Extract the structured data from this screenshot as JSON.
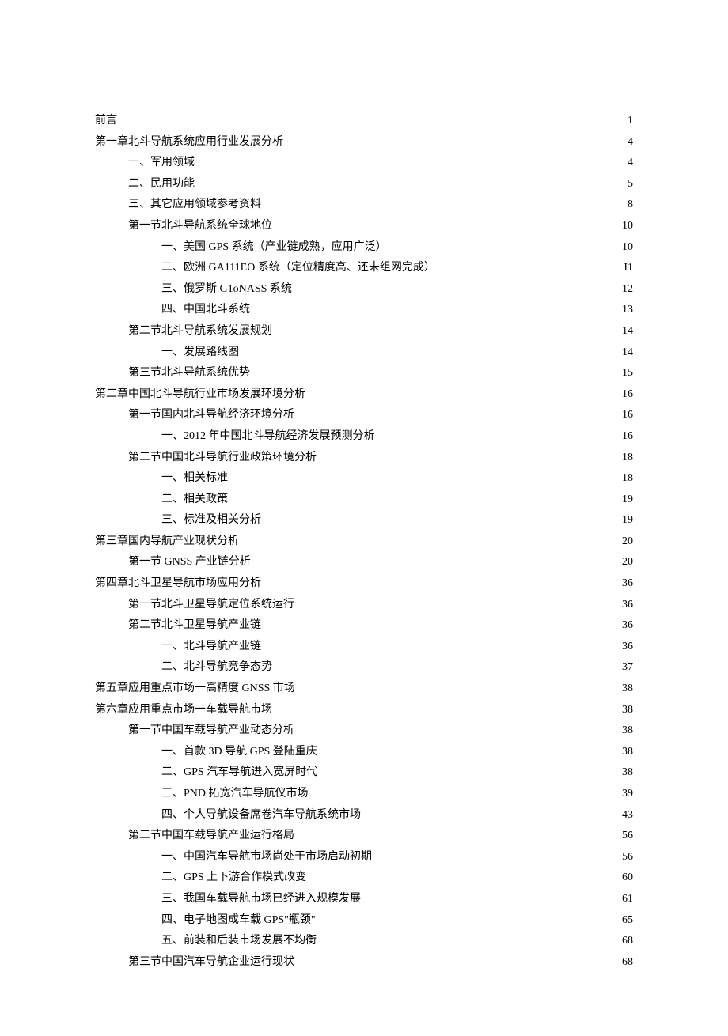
{
  "toc": [
    {
      "level": 0,
      "label": "前言",
      "page": "1"
    },
    {
      "level": 0,
      "label": "第一章北斗导航系统应用行业发展分析",
      "page": "4"
    },
    {
      "level": 1,
      "label": "一、军用领域",
      "page": "4"
    },
    {
      "level": 1,
      "label": "二、民用功能",
      "page": "5"
    },
    {
      "level": 1,
      "label": "三、其它应用领域参考资料",
      "page": "8"
    },
    {
      "level": 1,
      "label": "第一节北斗导航系统全球地位",
      "page": "10"
    },
    {
      "level": 2,
      "label": "一、美国 GPS 系统（产业链成熟，应用广泛）",
      "page": "10"
    },
    {
      "level": 2,
      "label": "二、欧洲 GA111EO 系统（定位精度高、还未组网完成）",
      "page": "I1"
    },
    {
      "level": 2,
      "label": "三、俄罗斯 G1oNASS 系统",
      "page": "12"
    },
    {
      "level": 2,
      "label": "四、中国北斗系统",
      "page": "13"
    },
    {
      "level": 1,
      "label": "第二节北斗导航系统发展规划",
      "page": "14"
    },
    {
      "level": 2,
      "label": "一、发展路线图",
      "page": "14"
    },
    {
      "level": 1,
      "label": "第三节北斗导航系统优势",
      "page": "15"
    },
    {
      "level": 0,
      "label": "第二章中国北斗导航行业市场发展环境分析",
      "page": "16"
    },
    {
      "level": 1,
      "label": "第一节国内北斗导航经济环境分析",
      "page": "16"
    },
    {
      "level": 2,
      "label": "一、2012 年中国北斗导航经济发展预测分析",
      "page": "16"
    },
    {
      "level": 1,
      "label": "第二节中国北斗导航行业政策环境分析",
      "page": "18"
    },
    {
      "level": 2,
      "label": "一、相关标准",
      "page": "18"
    },
    {
      "level": 2,
      "label": "二、相关政策",
      "page": "19"
    },
    {
      "level": 2,
      "label": "三、标准及相关分析",
      "page": "19"
    },
    {
      "level": 0,
      "label": "第三章国内导航产业现状分析",
      "page": "20"
    },
    {
      "level": 1,
      "label": "第一节 GNSS 产业链分析",
      "page": "20"
    },
    {
      "level": 0,
      "label": "第四章北斗卫星导航市场应用分析",
      "page": "36"
    },
    {
      "level": 1,
      "label": "第一节北斗卫星导航定位系统运行",
      "page": "36"
    },
    {
      "level": 1,
      "label": "第二节北斗卫星导航产业链",
      "page": "36"
    },
    {
      "level": 2,
      "label": "一、北斗导航产业链",
      "page": "36"
    },
    {
      "level": 2,
      "label": "二、北斗导航竞争态势",
      "page": "37"
    },
    {
      "level": 0,
      "label": "第五章应用重点市场一高精度 GNSS 市场",
      "page": "38"
    },
    {
      "level": 0,
      "label": "第六章应用重点市场一车载导航市场",
      "page": "38"
    },
    {
      "level": 1,
      "label": "第一节中国车载导航产业动态分析",
      "page": "38"
    },
    {
      "level": 2,
      "label": "一、首款 3D 导航 GPS 登陆重庆",
      "page": "38"
    },
    {
      "level": 2,
      "label": "二、GPS 汽车导航进入宽屏时代",
      "page": "38"
    },
    {
      "level": 2,
      "label": "三、PND 拓宽汽车导航仪市场",
      "page": "39"
    },
    {
      "level": 2,
      "label": "四、个人导航设备席卷汽车导航系统市场",
      "page": "43"
    },
    {
      "level": 1,
      "label": "第二节中国车载导航产业运行格局",
      "page": "56"
    },
    {
      "level": 2,
      "label": "一、中国汽车导航市场尚处于市场启动初期",
      "page": "56"
    },
    {
      "level": 2,
      "label": "二、GPS 上下游合作模式改变",
      "page": "60"
    },
    {
      "level": 2,
      "label": "三、我国车载导航市场已经进入规模发展",
      "page": "61"
    },
    {
      "level": 2,
      "label": "四、电子地图成车载 GPS\"瓶颈\"",
      "page": "65"
    },
    {
      "level": 2,
      "label": "五、前装和后装市场发展不均衡",
      "page": "68"
    },
    {
      "level": 1,
      "label": "第三节中国汽车导航企业运行现状",
      "page": "68"
    }
  ]
}
